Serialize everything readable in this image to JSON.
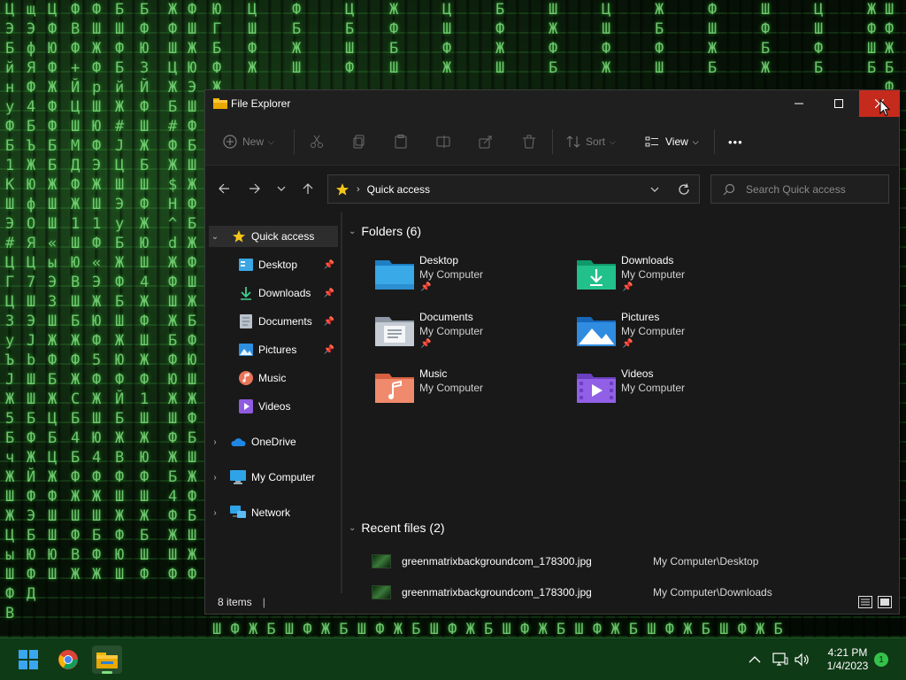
{
  "window": {
    "title": "File Explorer"
  },
  "toolbar": {
    "new_label": "New",
    "sort_label": "Sort",
    "view_label": "View",
    "more_label": "•••"
  },
  "address": {
    "location": "Quick access",
    "search_placeholder": "Search Quick access"
  },
  "sidebar": {
    "quick_access": "Quick access",
    "items": [
      {
        "label": "Desktop",
        "pinned": true
      },
      {
        "label": "Downloads",
        "pinned": true
      },
      {
        "label": "Documents",
        "pinned": true
      },
      {
        "label": "Pictures",
        "pinned": true
      },
      {
        "label": "Music",
        "pinned": false
      },
      {
        "label": "Videos",
        "pinned": false
      }
    ],
    "onedrive": "OneDrive",
    "my_computer": "My Computer",
    "network": "Network"
  },
  "content": {
    "folders_header": "Folders (6)",
    "folders": [
      {
        "name": "Desktop",
        "location": "My Computer",
        "pinned": true
      },
      {
        "name": "Downloads",
        "location": "My Computer",
        "pinned": true
      },
      {
        "name": "Documents",
        "location": "My Computer",
        "pinned": true
      },
      {
        "name": "Pictures",
        "location": "My Computer",
        "pinned": true
      },
      {
        "name": "Music",
        "location": "My Computer",
        "pinned": false
      },
      {
        "name": "Videos",
        "location": "My Computer",
        "pinned": false
      }
    ],
    "recent_header": "Recent files (2)",
    "recent": [
      {
        "name": "greenmatrixbackgroundcom_178300.jpg",
        "path": "My Computer\\Desktop"
      },
      {
        "name": "greenmatrixbackgroundcom_178300.jpg",
        "path": "My Computer\\Downloads"
      }
    ]
  },
  "status": {
    "items": "8 items"
  },
  "taskbar": {
    "time": "4:21 PM",
    "date": "1/4/2023",
    "notifications": "1"
  },
  "colors": {
    "close_button": "#c42b1c",
    "window_bg": "#191919",
    "taskbar_bg": "#0f3a16",
    "matrix_green": "#7fe27f"
  }
}
